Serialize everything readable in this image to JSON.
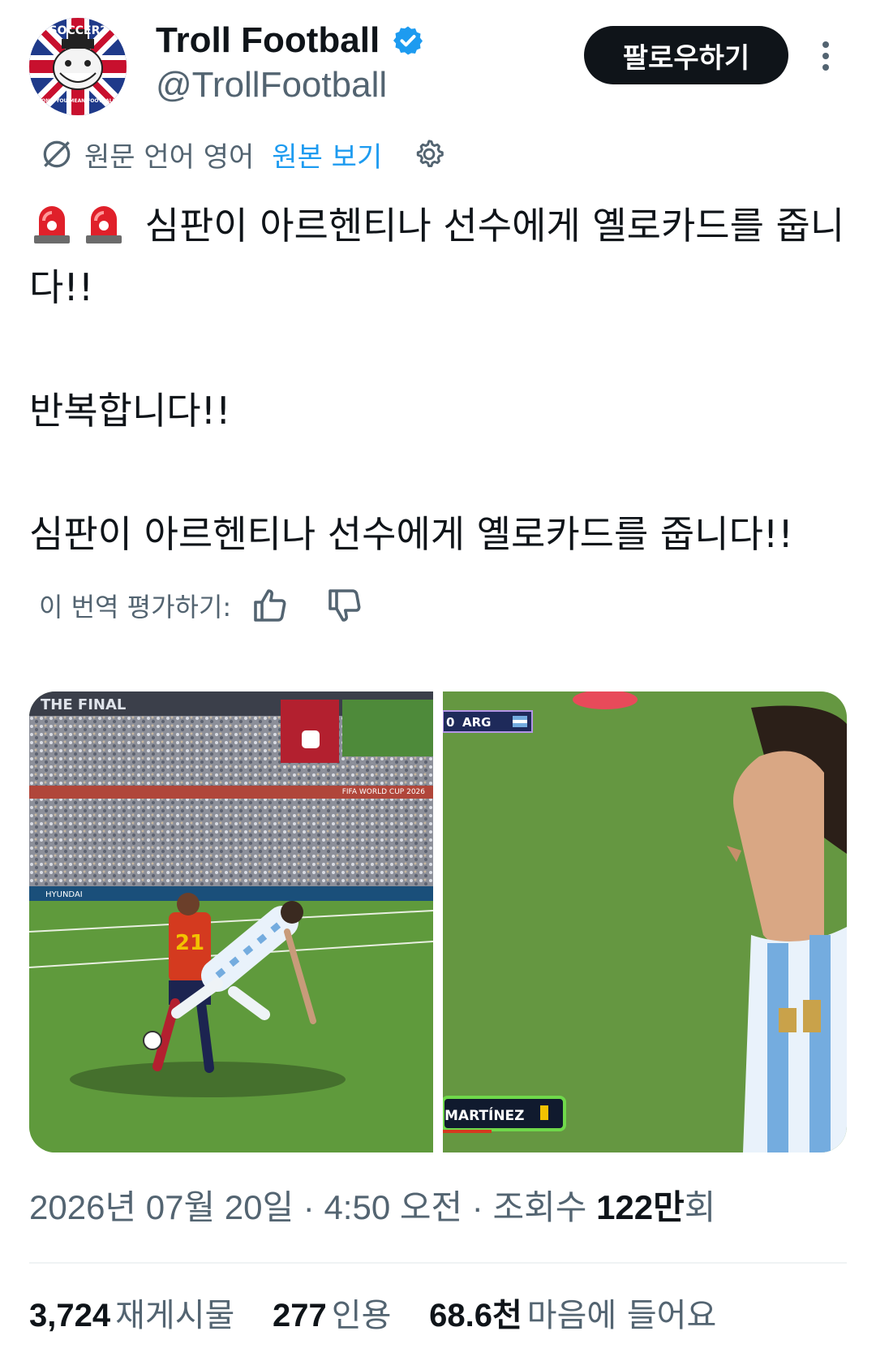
{
  "account": {
    "display_name": "Troll Football",
    "handle": "@TrollFootball",
    "avatar_top_text": "SOCCER?",
    "avatar_bottom_text": "DON'T YOU MEAN FOOTBALL?",
    "verified": true
  },
  "follow_label": "팔로우하기",
  "translation": {
    "source_language": "원문 언어 영어",
    "show_original": "원본 보기"
  },
  "tweet": {
    "line1": "심판이 아르헨티나 선수에게 옐로카드를 줍니다!!",
    "line2": "반복합니다!!",
    "line3": "심판이 아르헨티나 선수에게 옐로카드를 줍니다!!"
  },
  "rate_translation_label": "이 번역 평가하기:",
  "media": {
    "left_overlay": "THE FINAL",
    "left_banner": "FIFA WORLD CUP 2026",
    "left_board": "HYUNDAI",
    "left_jersey": "21",
    "right_scorebug": "ARG",
    "right_scorebug_digit": "0",
    "right_nameplate": "MARTÍNEZ"
  },
  "meta": {
    "timestamp": "2026년 07월 20일 · 4:50 오전 · 조회수 ",
    "views_number": "122만",
    "views_suffix": "회"
  },
  "stats": {
    "reposts": {
      "count": "3,724",
      "label": "재게시물"
    },
    "quotes": {
      "count": "277",
      "label": "인용"
    },
    "likes": {
      "count": "68.6천",
      "label": "마음에 들어요"
    }
  },
  "colors": {
    "accent": "#1d9bf0",
    "text_primary": "#0f1419",
    "text_secondary": "#536471",
    "follow_button": "#0f1419",
    "pitch_green": "#5f9a3c"
  }
}
